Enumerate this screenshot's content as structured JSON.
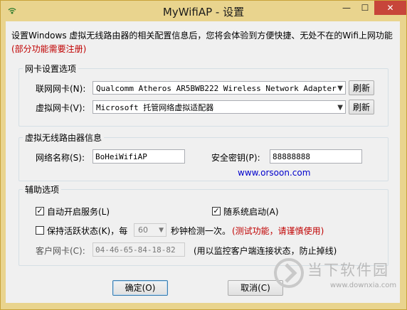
{
  "window": {
    "title": "MyWifiAP - 设置",
    "minimize": "—",
    "maximize": "☐",
    "close": "✕"
  },
  "intro": {
    "text": "设置Windows 虚拟无线路由器的相关配置信息后，您将会体验到方便快捷、无处不在的Wifi上网功能",
    "note": "(部分功能需要注册)"
  },
  "nic_group": {
    "title": "网卡设置选项",
    "internet_label": "联网网卡(N):",
    "internet_value": "Qualcomm Atheros AR5BWB222 Wireless Network Adapter",
    "virtual_label": "虚拟网卡(V):",
    "virtual_value": "Microsoft 托管网络虚拟适配器",
    "refresh1": "刷新",
    "refresh2": "刷新"
  },
  "router_group": {
    "title": "虚拟无线路由器信息",
    "ssid_label": "网络名称(S):",
    "ssid_value": "BoHeiWifiAP",
    "key_label": "安全密钥(P):",
    "key_value": "88888888",
    "link": "www.orsoon.com"
  },
  "aux_group": {
    "title": "辅助选项",
    "autostart_label": "自动开启服务(L)",
    "autostart_checked": true,
    "boot_label": "随系统启动(A)",
    "boot_checked": true,
    "keepalive_label": "保持活跃状态(K)，每",
    "keepalive_checked": false,
    "interval_value": "60",
    "interval_suffix": "秒钟检测一次。",
    "interval_note": "(测试功能，请谨慎使用)",
    "client_label": "客户网卡(C):",
    "client_value": "04-46-65-84-18-82",
    "client_note": "(用以监控客户端连接状态，防止掉线)"
  },
  "buttons": {
    "ok": "确定(O)",
    "cancel": "取消(C)"
  },
  "watermark": {
    "brand": "当下软件园",
    "url": "www.downxia.com"
  },
  "colors": {
    "titlebar": "#e9d48e",
    "close": "#c7453a",
    "note_red": "#c00000",
    "link_blue": "#0000cc"
  }
}
